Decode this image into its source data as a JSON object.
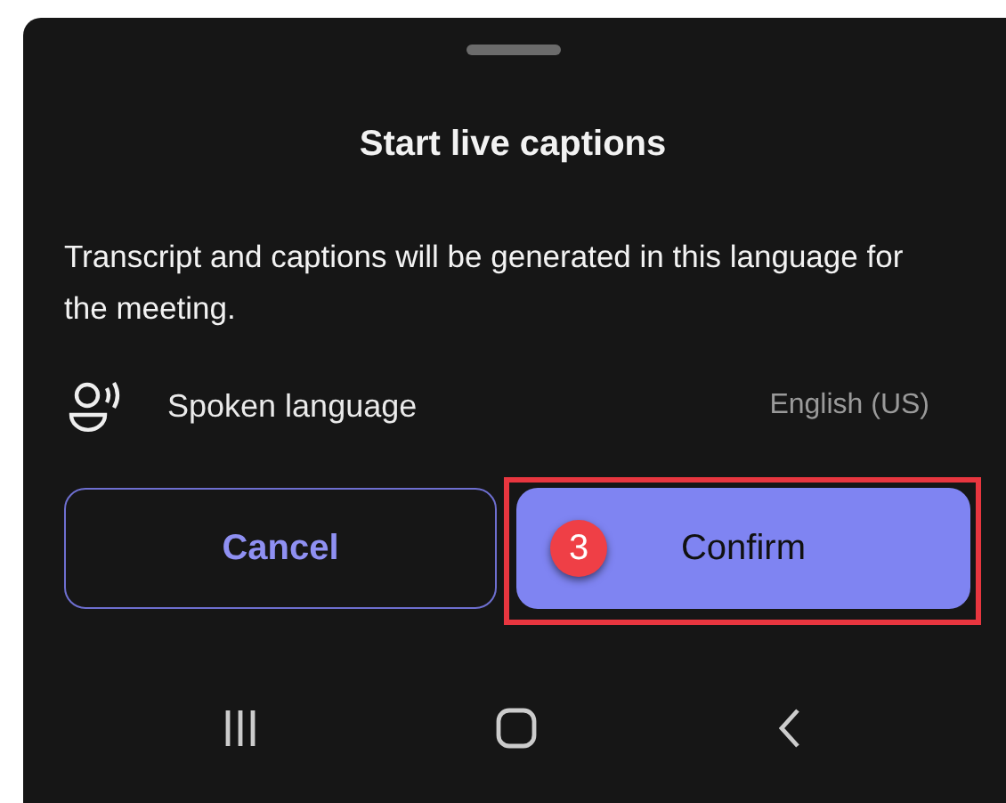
{
  "sheet": {
    "title": "Start live captions",
    "description": "Transcript and captions will be generated in this language for the meeting."
  },
  "setting": {
    "label": "Spoken language",
    "value": "English (US)"
  },
  "buttons": [
    {
      "label": "Cancel",
      "kind": "secondary",
      "highlighted": false
    },
    {
      "label": "Confirm",
      "kind": "primary",
      "highlighted": true,
      "badge": "3"
    }
  ],
  "nav_bar": [
    {
      "kind": "recents"
    },
    {
      "kind": "home"
    },
    {
      "kind": "back"
    }
  ]
}
